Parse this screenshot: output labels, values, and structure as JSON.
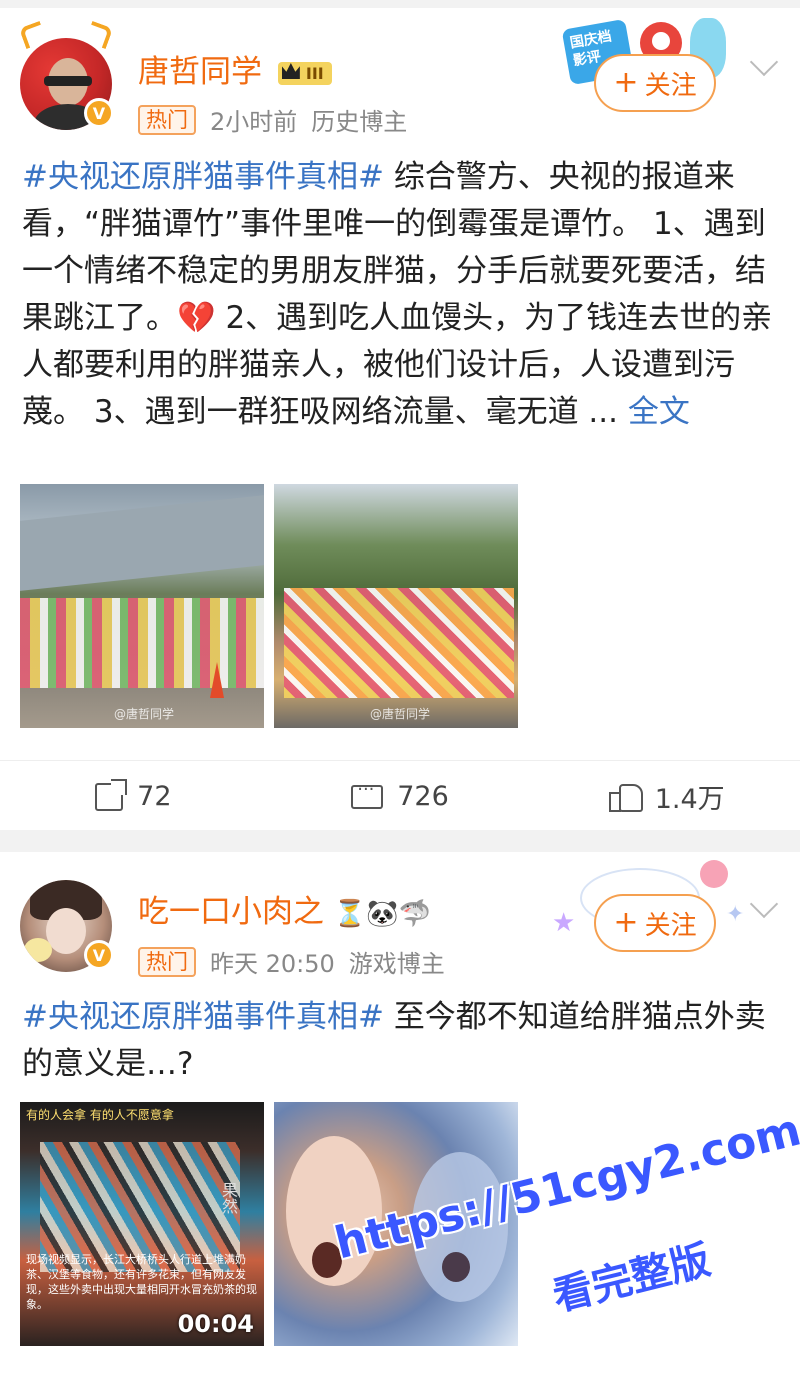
{
  "posts": [
    {
      "username": "唐哲同学",
      "level_badge": "III",
      "tag": "热门",
      "time": "2小时前",
      "category": "历史博主",
      "follow_label": "关注",
      "topic": "#央视还原胖猫事件真相#",
      "text": "综合警方、央视的报道来看，“胖猫谭竹”事件里唯一的倒霉蛋是谭竹。 1、遇到一个情绪不稳定的男朋友胖猫，分手后就要死要活，结果跳江了。💔 2、遇到吃人血馒头，为了钱连去世的亲人都要利用的胖猫亲人，被他们设计后，人设遭到污蔑。 3、遇到一群狂吸网络流量、毫无道 ...",
      "more_label": "全文",
      "image_watermarks": [
        "@唐哲同学",
        "@唐哲同学"
      ],
      "stats": {
        "repost": "72",
        "comment": "726",
        "like": "1.4万"
      },
      "deco_label": "国庆档影评"
    },
    {
      "username": "吃一口小肉之",
      "username_emojis": "⏳🐼🦈",
      "tag": "热门",
      "time": "昨天 20:50",
      "category": "游戏博主",
      "follow_label": "关注",
      "topic": "#央视还原胖猫事件真相#",
      "text": "至今都不知道给胖猫点外卖的意义是…?",
      "video_top_caption": "有的人会拿 有的人不愿意拿",
      "video_bottom_caption": "现场视频显示，长江大桥桥头人行道上堆满奶茶、汉堡等食物，还有许多花束，但有网友发现，这些外卖中出现大量相同开水冒充奶茶的现象。",
      "video_mark": "果然",
      "video_duration": "00:04"
    }
  ],
  "overlay": {
    "url": "https://51cgy2.com",
    "subtitle": "看完整版"
  },
  "colors": {
    "accent_orange": "#f06a10",
    "topic_blue": "#3a74c4",
    "overlay_blue": "#3a58ff"
  }
}
